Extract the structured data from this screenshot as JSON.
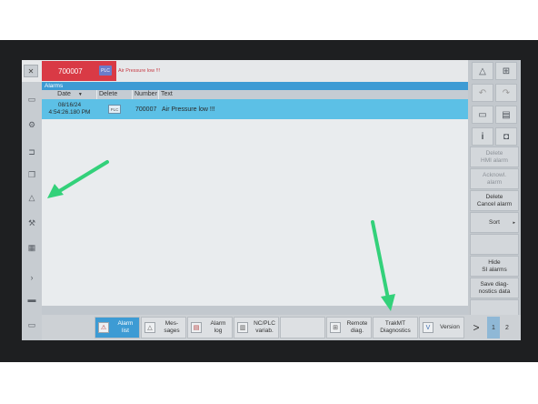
{
  "header": {
    "alarm_number": "700007",
    "plc_chip": "PLC",
    "message": "Air Pressure low !!!"
  },
  "panel": {
    "title": "Alarms",
    "columns": [
      "Date",
      "Delete",
      "Number",
      "Text"
    ],
    "rows": [
      {
        "date": "08/16/24\n4:54:26.180 PM",
        "delete_chip": "PLC",
        "number": "700007",
        "text": "Air Pressure low !!!"
      }
    ]
  },
  "right_buttons": [
    {
      "label": "Delete\nHMI alarm",
      "enabled": false
    },
    {
      "label": "Acknowl.\nalarm",
      "enabled": false
    },
    {
      "label": "Delete\nCancel alarm",
      "enabled": true
    },
    {
      "label": "Sort",
      "enabled": true
    },
    {
      "label": "Hide\nSI alarms",
      "enabled": true
    },
    {
      "label": "Save diag-\nnostics data",
      "enabled": true
    }
  ],
  "softkeys": [
    {
      "label": "Alarm\nlist",
      "active": true
    },
    {
      "label": "Mes-\nsages",
      "active": false
    },
    {
      "label": "Alarm\nlog",
      "active": false
    },
    {
      "label": "NC/PLC\nvariab.",
      "active": false
    },
    {
      "label": "Remote\ndiag.",
      "active": false
    },
    {
      "label": "TrakMT\nDiagnostics",
      "active": false
    },
    {
      "label": "Version",
      "active": false
    }
  ],
  "page_nav": {
    "next": ">",
    "page1": "1",
    "page2": "2"
  },
  "colors": {
    "accent": "#3d9bd4",
    "alarm_red": "#d93a45",
    "selected_row": "#5cc0e6",
    "arrow_green": "#33d17a"
  }
}
